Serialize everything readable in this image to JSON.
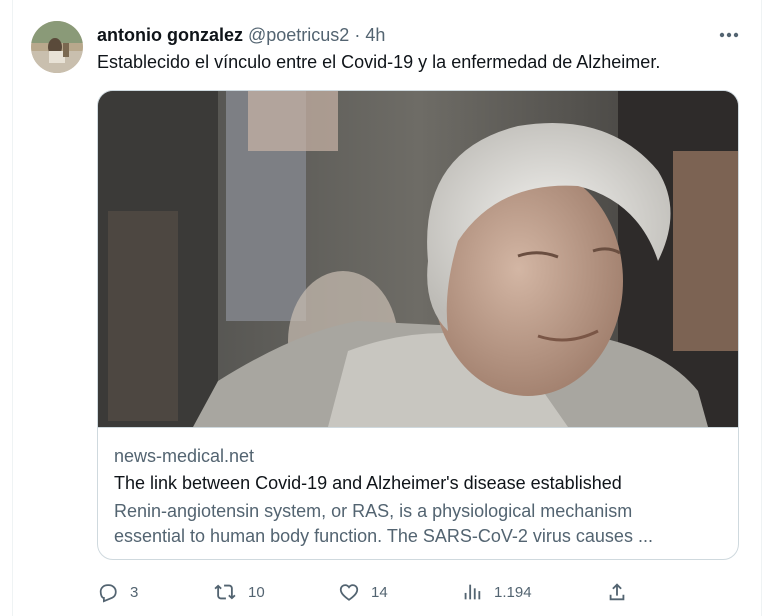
{
  "tweet": {
    "author_name": "antonio gonzalez",
    "author_handle": "@poetricus2",
    "separator": "·",
    "time": "4h",
    "text": "Establecido el vínculo entre el Covid-19 y la enfermedad de Alzheimer."
  },
  "card": {
    "domain": "news-medical.net",
    "title": "The link between Covid-19 and Alzheimer's disease established",
    "description_line1": "Renin-angiotensin system, or RAS, is a physiological mechanism",
    "description_line2": "essential to human body function. The SARS-CoV-2 virus causes ..."
  },
  "actions": {
    "replies": "3",
    "reposts": "10",
    "likes": "14",
    "views": "1.194"
  },
  "icons": {
    "more": "more-horizontal-icon",
    "reply": "reply-icon",
    "repost": "repost-icon",
    "like": "heart-icon",
    "views": "views-chart-icon",
    "share": "share-icon"
  },
  "colors": {
    "text_primary": "#0f1419",
    "text_secondary": "#536471",
    "border": "#cfd9de"
  }
}
